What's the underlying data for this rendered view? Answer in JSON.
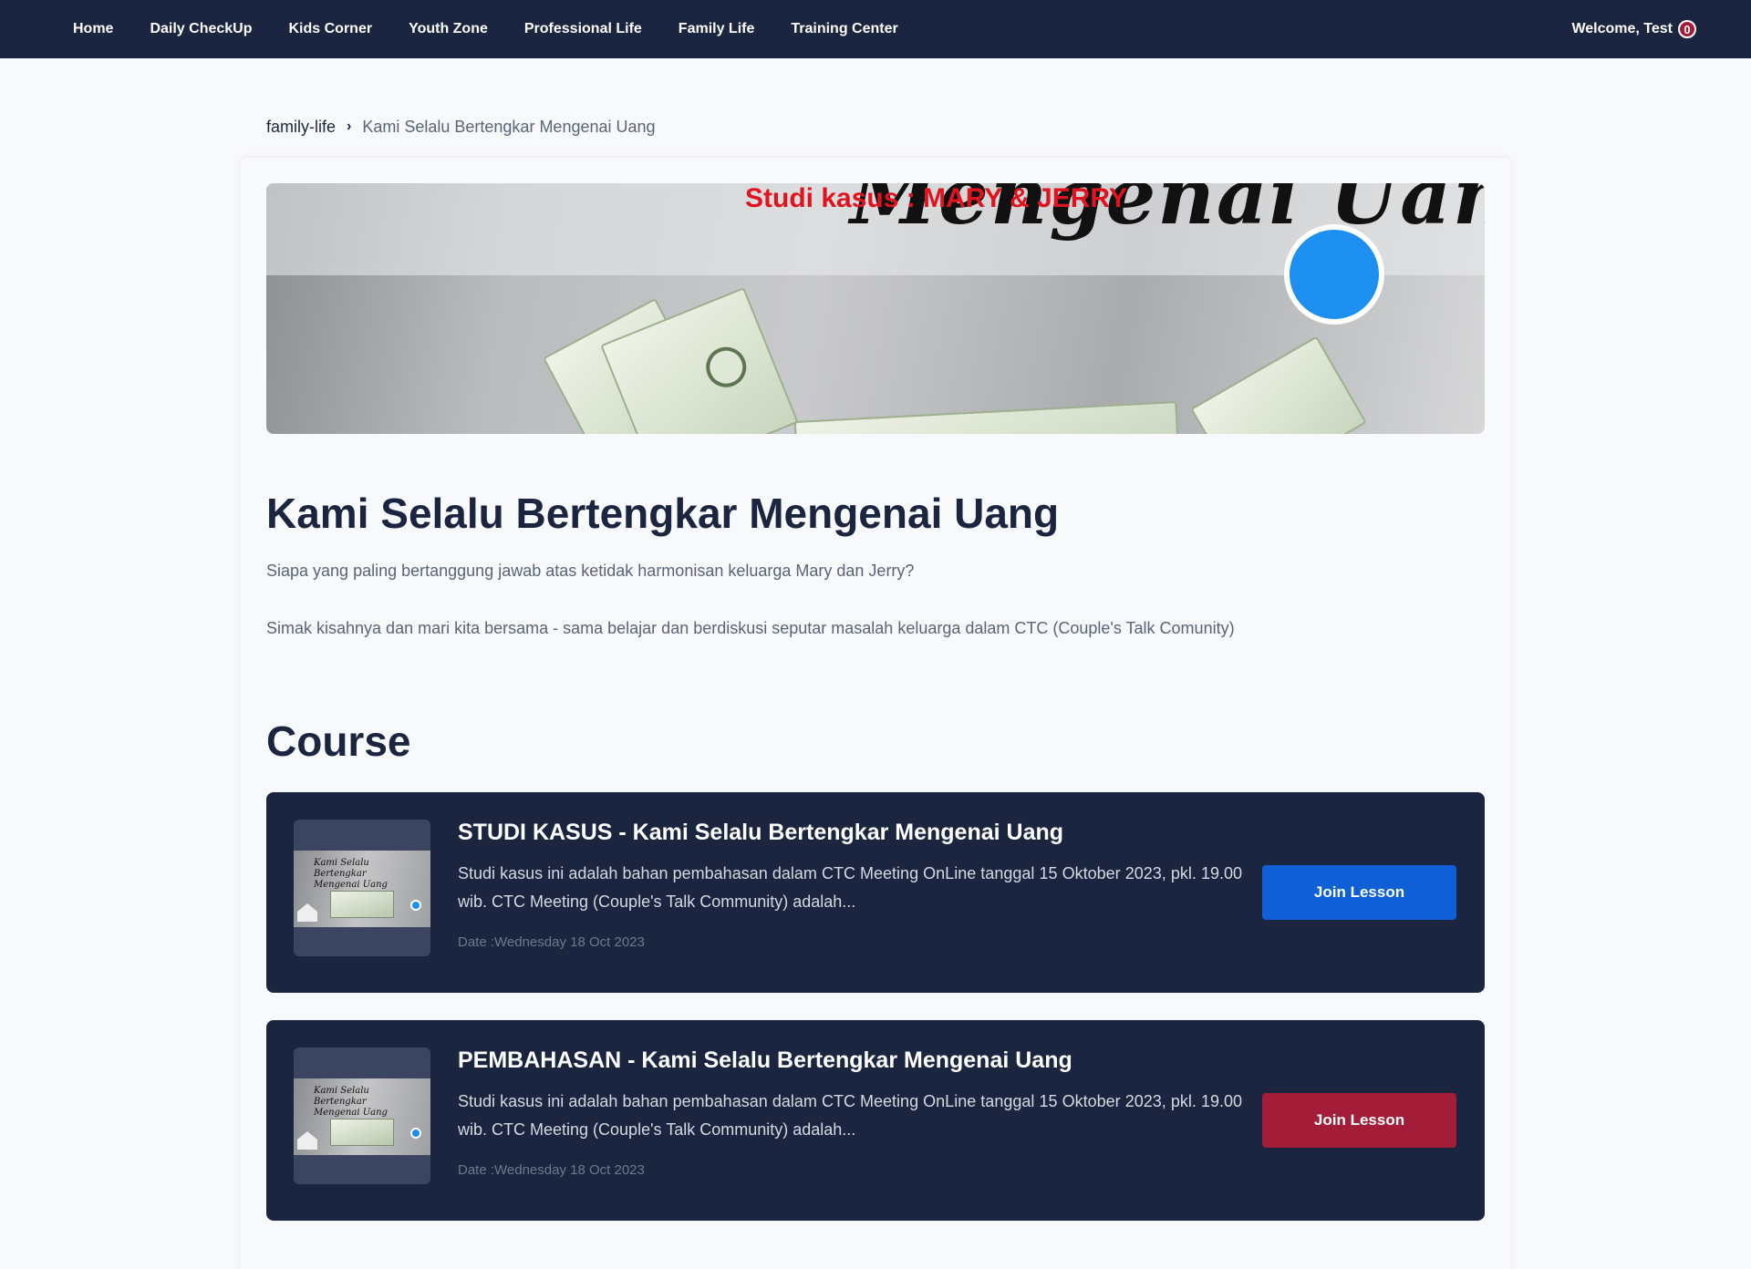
{
  "nav": {
    "items": [
      "Home",
      "Daily CheckUp",
      "Kids Corner",
      "Youth Zone",
      "Professional Life",
      "Family Life",
      "Training Center"
    ],
    "welcome": "Welcome, Test",
    "badge": "0"
  },
  "breadcrumb": {
    "parent": "family-life",
    "current": "Kami Selalu Bertengkar Mengenai Uang"
  },
  "banner": {
    "script_text": "Mengenai Uang",
    "subtitle": "Studi kasus : MARY & JERRY"
  },
  "page": {
    "title": "Kami Selalu Bertengkar Mengenai Uang",
    "desc1": "Siapa yang paling bertanggung jawab atas ketidak harmonisan keluarga Mary dan Jerry?",
    "desc2": "Simak kisahnya dan mari kita bersama - sama belajar dan berdiskusi seputar masalah keluarga dalam CTC (Couple's Talk Comunity)",
    "section_title": "Course"
  },
  "lessons": [
    {
      "title": "STUDI KASUS - Kami Selalu Bertengkar Mengenai Uang",
      "desc": "Studi kasus ini adalah bahan pembahasan dalam CTC Meeting OnLine tanggal 15 Oktober 2023, pkl. 19.00 wib. CTC Meeting (Couple's Talk Community) adalah...",
      "date": "Date :Wednesday 18 Oct 2023",
      "button": "Join Lesson",
      "button_color": "#0f5fd6",
      "thumb_text": "Kami Selalu Bertengkar Mengenai Uang"
    },
    {
      "title": "PEMBAHASAN - Kami Selalu Bertengkar Mengenai Uang",
      "desc": "Studi kasus ini adalah bahan pembahasan dalam CTC Meeting OnLine tanggal 15 Oktober 2023, pkl. 19.00 wib. CTC Meeting (Couple's Talk Community) adalah...",
      "date": "Date :Wednesday 18 Oct 2023",
      "button": "Join Lesson",
      "button_color": "#a31d38",
      "thumb_text": "Kami Selalu Bertengkar Mengenai Uang"
    }
  ],
  "colors": {
    "navy": "#1b2540",
    "badge": "#a31d38"
  }
}
